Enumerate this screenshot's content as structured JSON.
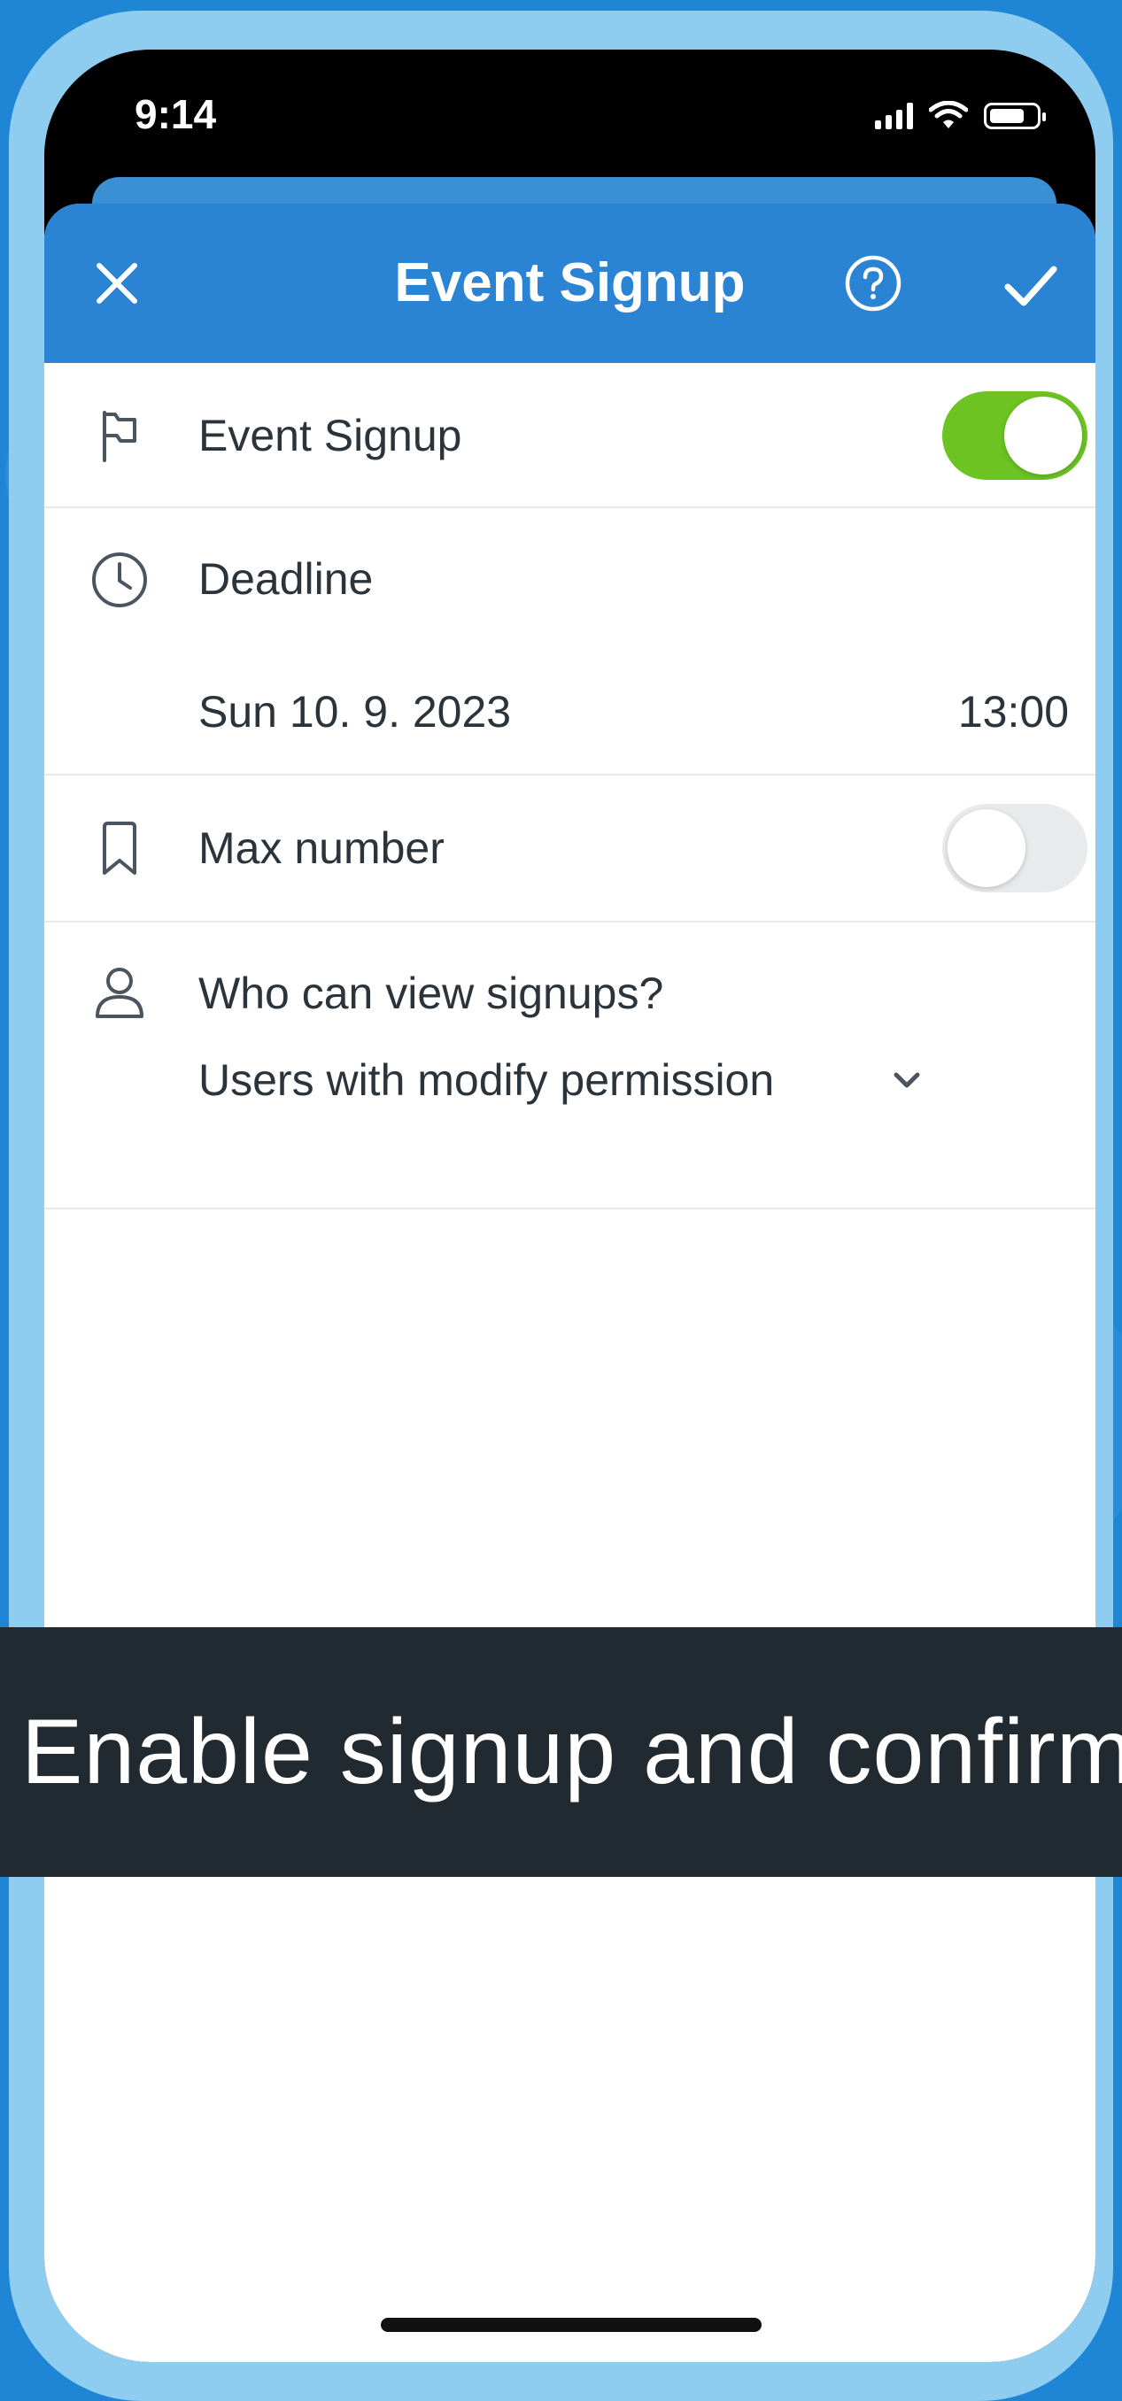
{
  "status_bar": {
    "time": "9:14"
  },
  "header": {
    "title": "Event Signup",
    "close_icon": "close-icon",
    "help_icon": "help-circle-icon",
    "confirm_icon": "check-icon",
    "background_color": "#2a83d3"
  },
  "rows": {
    "event_signup": {
      "label": "Event Signup",
      "icon": "flag-icon",
      "toggle_on": true
    },
    "deadline": {
      "label": "Deadline",
      "icon": "clock-icon",
      "date": "Sun 10. 9. 2023",
      "time": "13:00"
    },
    "max_number": {
      "label": "Max number",
      "icon": "bookmark-icon",
      "toggle_on": false
    },
    "who_can_view": {
      "label": "Who can view signups?",
      "icon": "person-icon",
      "selected": "Users with modify permission",
      "chevron_icon": "chevron-down-icon"
    }
  },
  "caption": {
    "text": "Enable signup and confirm"
  },
  "colors": {
    "toggle_on": "#6cc322",
    "toggle_off": "#e9eaec",
    "page_background": "#1f86d6"
  }
}
